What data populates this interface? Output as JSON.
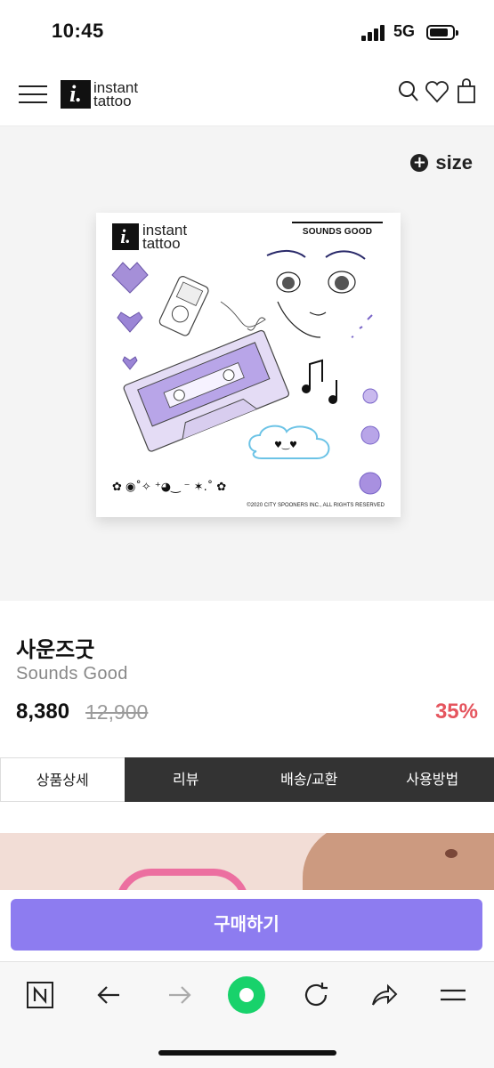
{
  "status_bar": {
    "time": "10:45",
    "network": "5G"
  },
  "header": {
    "logo_mark": "i.",
    "logo_line1": "instant",
    "logo_line2": "tattoo",
    "icons": [
      "menu-icon",
      "search-icon",
      "heart-icon",
      "shopping-bag-icon"
    ]
  },
  "product_image": {
    "size_label": "size",
    "card_logo_mark": "i.",
    "card_logo_line1": "instant",
    "card_logo_line2": "tattoo",
    "card_title": "SOUNDS GOOD",
    "copyright": "©2020 CITY SPOONERS INC., ALL RIGHTS RESERVED"
  },
  "product": {
    "name_ko": "사운즈굿",
    "name_en": "Sounds Good",
    "price": "8,380",
    "original_price": "12,900",
    "discount": "35%"
  },
  "tabs": [
    {
      "label": "상품상세",
      "active": true
    },
    {
      "label": "리뷰",
      "active": false
    },
    {
      "label": "배송/교환",
      "active": false
    },
    {
      "label": "사용방법",
      "active": false
    }
  ],
  "buy_button": {
    "label": "구매하기"
  },
  "colors": {
    "accent": "#8d7cf0",
    "discount": "#e5555e",
    "tab_dark": "#333333"
  },
  "browser_bar": {
    "icons": [
      "naver-n-icon",
      "back-arrow-icon",
      "forward-arrow-icon",
      "green-home-dot-icon",
      "refresh-icon",
      "share-icon",
      "menu-lines-icon"
    ]
  }
}
